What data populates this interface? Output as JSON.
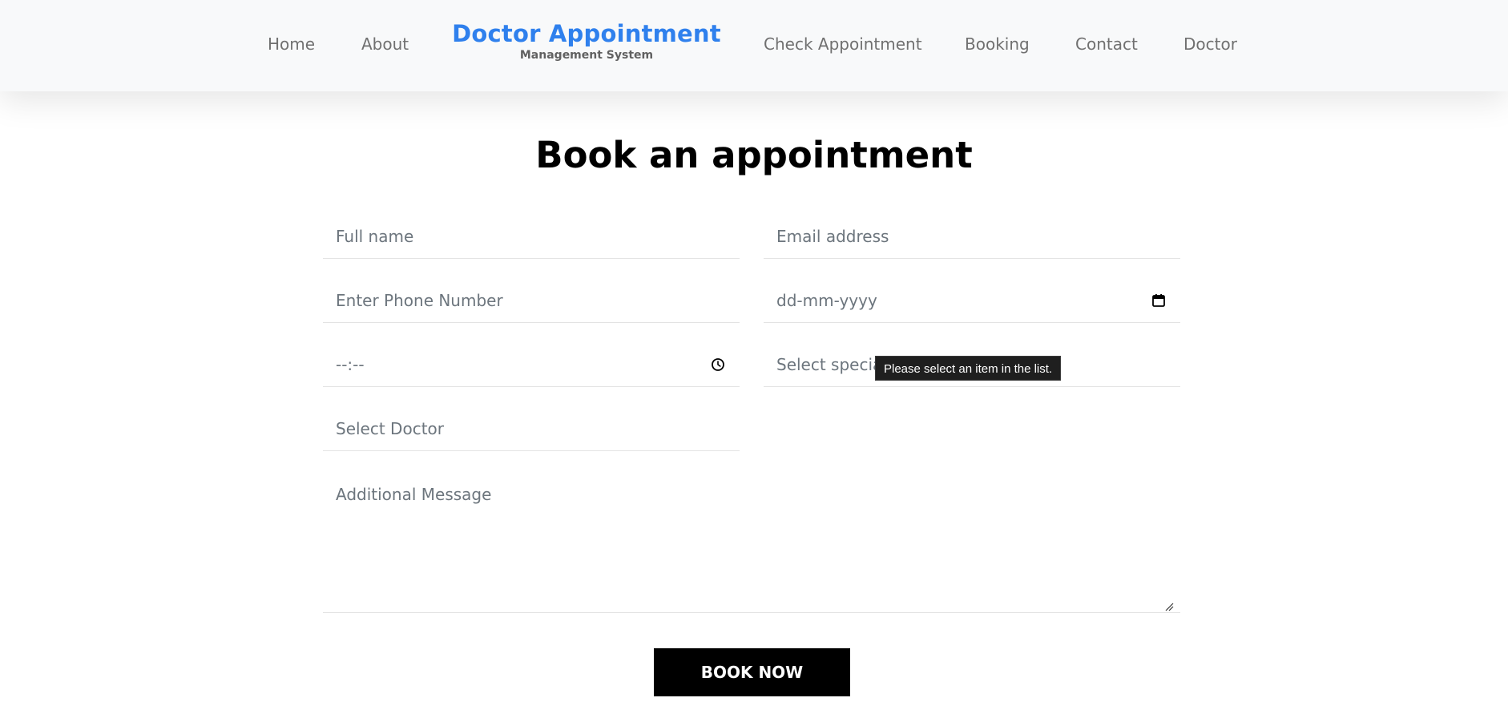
{
  "nav": {
    "left_links": [
      "Home",
      "About"
    ],
    "right_links": [
      "Check Appointment",
      "Booking",
      "Contact",
      "Doctor"
    ],
    "brand_title": "Doctor Appointment",
    "brand_subtitle": "Management System"
  },
  "page": {
    "title": "Book an appointment"
  },
  "form": {
    "full_name_placeholder": "Full name",
    "email_placeholder": "Email address",
    "phone_placeholder": "Enter Phone Number",
    "date_display": "dd-mm-yyyy",
    "time_display": "--:--",
    "specialty_display": "Select special",
    "doctor_display": "Select Doctor",
    "message_placeholder": "Additional Message",
    "submit_label": "BOOK NOW"
  },
  "tooltip": {
    "text": "Please select an item in the list."
  },
  "icons": {
    "date": "calendar-icon",
    "time": "clock-icon",
    "resize": "resize-handle-icon"
  },
  "colors": {
    "brand": "#2f80ed",
    "header_bg": "#f8f9fa",
    "button_bg": "#000000"
  }
}
